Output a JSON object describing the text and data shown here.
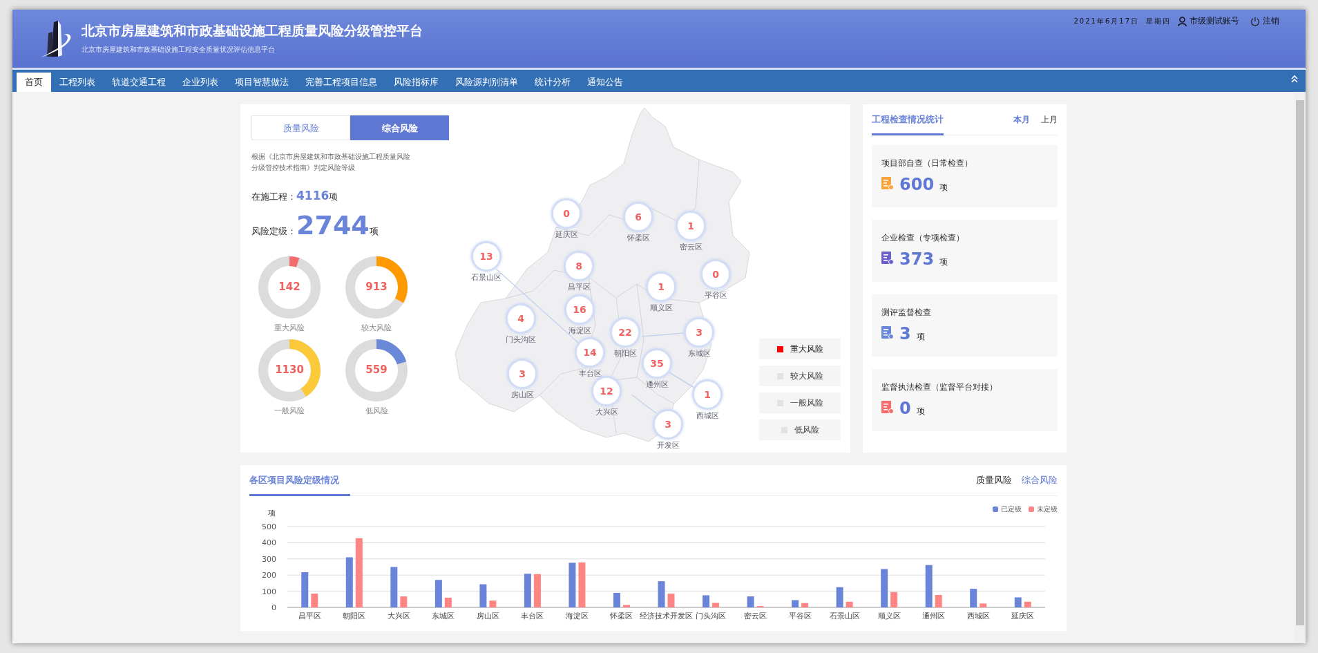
{
  "header": {
    "title": "北京市房屋建筑和市政基础设施工程质量风险分级管控平台",
    "subtitle": "北京市房屋建筑和市政基础设施工程安全质量状况评估信息平台",
    "date": "2021年6月17日",
    "weekday": "星期四",
    "user": "市级测试账号",
    "logout": "注销"
  },
  "nav": [
    {
      "label": "首页",
      "selected": true
    },
    {
      "label": "工程列表",
      "selected": false
    },
    {
      "label": "轨道交通工程",
      "selected": false
    },
    {
      "label": "企业列表",
      "selected": false
    },
    {
      "label": "项目智慧做法",
      "selected": false
    },
    {
      "label": "完善工程项目信息",
      "selected": false
    },
    {
      "label": "风险指标库",
      "selected": false
    },
    {
      "label": "风险源判别清单",
      "selected": false
    },
    {
      "label": "统计分析",
      "selected": false
    },
    {
      "label": "通知公告",
      "selected": false
    }
  ],
  "overview": {
    "tabs": [
      {
        "label": "质量风险",
        "selected": false
      },
      {
        "label": "综合风险",
        "selected": true
      }
    ],
    "note": "根据《北京市房屋建筑和市政基础设施工程质量风险分级管控技术指南》判定风险等级",
    "in_progress": {
      "label": "在施工程：",
      "value": "4116",
      "unit": "项"
    },
    "graded": {
      "label": "风险定级：",
      "value": "2744",
      "unit": "项"
    },
    "donuts": [
      {
        "value": "142",
        "label": "重大风险",
        "level": 0.052,
        "color": "#f36b6b"
      },
      {
        "value": "913",
        "label": "较大风险",
        "level": 0.333,
        "color": "#ff9900"
      },
      {
        "value": "1130",
        "label": "一般风险",
        "level": 0.41,
        "color": "#fcc93a"
      },
      {
        "value": "559",
        "label": "低风险",
        "level": 0.204,
        "color": "#6a88d8"
      }
    ]
  },
  "map": {
    "districts": [
      {
        "name": "延庆区",
        "count": "0"
      },
      {
        "name": "怀柔区",
        "count": "6"
      },
      {
        "name": "密云区",
        "count": "1"
      },
      {
        "name": "石景山区",
        "count": "13"
      },
      {
        "name": "昌平区",
        "count": "8"
      },
      {
        "name": "平谷区",
        "count": "0"
      },
      {
        "name": "顺义区",
        "count": "1"
      },
      {
        "name": "海淀区",
        "count": "16"
      },
      {
        "name": "门头沟区",
        "count": "4"
      },
      {
        "name": "朝阳区",
        "count": "22"
      },
      {
        "name": "东城区",
        "count": "3"
      },
      {
        "name": "丰台区",
        "count": "14"
      },
      {
        "name": "通州区",
        "count": "35"
      },
      {
        "name": "房山区",
        "count": "3"
      },
      {
        "name": "大兴区",
        "count": "12"
      },
      {
        "name": "西城区",
        "count": "1"
      },
      {
        "name": "开发区",
        "count": "3"
      }
    ],
    "legend": [
      {
        "label": "重大风险",
        "on": true
      },
      {
        "label": "较大风险",
        "on": false
      },
      {
        "label": "一般风险",
        "on": false
      },
      {
        "label": "低风险",
        "on": false
      }
    ]
  },
  "inspection": {
    "title": "工程检查情况统计",
    "periods": [
      {
        "label": "本月",
        "selected": true
      },
      {
        "label": "上月",
        "selected": false
      }
    ],
    "items": [
      {
        "title": "项目部自查（日常检查）",
        "value": "600",
        "unit": "项",
        "color": "#f9a43a"
      },
      {
        "title": "企业检查（专项检查）",
        "value": "373",
        "unit": "项",
        "color": "#6a5fc8"
      },
      {
        "title": "测评监督检查",
        "value": "3",
        "unit": "项",
        "color": "#6a88d8"
      },
      {
        "title": "监督执法检查（监督平台对接）",
        "value": "0",
        "unit": "项",
        "color": "#f36b6b"
      }
    ]
  },
  "district_chart": {
    "title": "各区项目风险定级情况",
    "modes": [
      {
        "label": "质量风险",
        "selected": false
      },
      {
        "label": "综合风险",
        "selected": true
      }
    ],
    "chart_data": {
      "type": "bar",
      "ylabel": "项",
      "categories": [
        "昌平区",
        "朝阳区",
        "大兴区",
        "东城区",
        "房山区",
        "丰台区",
        "海淀区",
        "怀柔区",
        "经济技术开发区",
        "门头沟区",
        "密云区",
        "平谷区",
        "石景山区",
        "顺义区",
        "通州区",
        "西城区",
        "延庆区"
      ],
      "series": [
        {
          "name": "已定级",
          "color": "#6a84d9",
          "values": [
            218,
            310,
            250,
            170,
            143,
            208,
            276,
            90,
            162,
            75,
            68,
            45,
            125,
            237,
            262,
            115,
            62
          ]
        },
        {
          "name": "未定级",
          "color": "#ff8585",
          "values": [
            85,
            428,
            68,
            60,
            42,
            206,
            278,
            15,
            85,
            28,
            8,
            27,
            35,
            95,
            77,
            24,
            35
          ]
        }
      ],
      "grid": true,
      "ylim": [
        0,
        500
      ],
      "yticks": [
        0,
        100,
        200,
        300,
        400,
        500
      ]
    }
  }
}
